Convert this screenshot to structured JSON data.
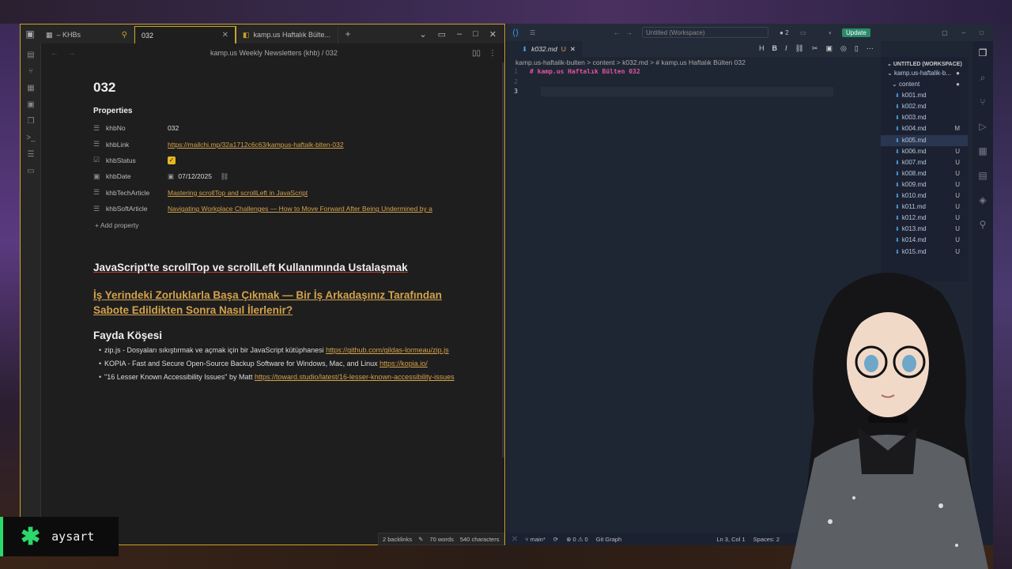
{
  "obsidian": {
    "tabs": [
      {
        "icon": "table-icon",
        "label": "– KHBs"
      },
      {
        "label": "032"
      },
      {
        "label": "kamp.us Haftalık Bülte..."
      }
    ],
    "breadcrumb": "kamp.us Weekly Newsletters (khb)  /  032",
    "note_title": "032",
    "properties_label": "Properties",
    "properties": [
      {
        "key": "khbNo",
        "value": "032"
      },
      {
        "key": "khbLink",
        "value": "https://mailchi.mp/32a1712c6c63/kampus-haftalk-blten-032"
      },
      {
        "key": "khbStatus",
        "value": "checked"
      },
      {
        "key": "khbDate",
        "value": "07/12/2025"
      },
      {
        "key": "khbTechArticle",
        "value": "Mastering scrollTop and scrollLeft in JavaScript"
      },
      {
        "key": "khbSoftArticle",
        "value": "Navigating Workplace Challenges — How to Move Forward After Being Undermined by a"
      }
    ],
    "add_property": "Add property",
    "heading1": "JavaScript'te scrollTop ve scrollLeft Kullanımında Ustalaşmak",
    "heading2": "İş Yerindeki Zorluklarla Başa Çıkmak — Bir İş Arkadaşınız Tarafından Sabote Edildikten Sonra Nasıl İlerlenir?",
    "heading3": "Fayda Köşesi",
    "list": [
      {
        "text": "zip.js - Dosyaları sıkıştırmak ve açmak için bir JavaScript kütüphanesi ",
        "link": "https://github.com/gildas-lormeau/zip.js"
      },
      {
        "text": "KOPIA - Fast and Secure Open-Source Backup Software for Windows, Mac, and Linux ",
        "link": "https://kopia.io/"
      },
      {
        "text": "\"16 Lesser Known Accessibility Issues\" by Matt ",
        "link": "https://toward.studio/latest/16-lesser-known-accessibility-issues"
      }
    ],
    "status": {
      "backlinks": "2 backlinks",
      "words": "70 words",
      "chars": "540 characters"
    }
  },
  "vscode": {
    "workspace": "Untitled (Workspace)",
    "update": "Update",
    "notif_count": "2",
    "tab": {
      "label": "k032.md",
      "state": "U"
    },
    "breadcrumb": "kamp.us-haftalik-bulten  >  content  >  k032.md  >  # kamp.us Haftalık Bülten 032",
    "lines": [
      {
        "n": "1",
        "text": "# kamp.us Haftalık Bülten 032"
      },
      {
        "n": "2",
        "text": ""
      },
      {
        "n": "3",
        "text": ""
      }
    ],
    "explorer": {
      "header": "UNTITLED (WORKSPACE)",
      "root": "kamp.us-haftalik-b...",
      "folder": "content",
      "files": [
        {
          "name": "k001.md",
          "st": ""
        },
        {
          "name": "k002.md",
          "st": ""
        },
        {
          "name": "k003.md",
          "st": ""
        },
        {
          "name": "k004.md",
          "st": "M"
        },
        {
          "name": "k005.md",
          "st": ""
        },
        {
          "name": "k006.md",
          "st": "U"
        },
        {
          "name": "k007.md",
          "st": "U"
        },
        {
          "name": "k008.md",
          "st": "U"
        },
        {
          "name": "k009.md",
          "st": "U"
        },
        {
          "name": "k010.md",
          "st": "U"
        },
        {
          "name": "k011.md",
          "st": "U"
        },
        {
          "name": "k012.md",
          "st": "U"
        },
        {
          "name": "k013.md",
          "st": "U"
        },
        {
          "name": "k014.md",
          "st": "U"
        },
        {
          "name": "k015.md",
          "st": "U"
        }
      ]
    },
    "status": {
      "branch": "main*",
      "errors": "0",
      "warnings": "0",
      "git_graph": "Git Graph",
      "position": "Ln 3, Col 1",
      "spaces": "Spaces: 2"
    }
  },
  "badge": {
    "name": "aysart"
  },
  "colors": {
    "accent": "#c9a227",
    "link": "#d4a24c",
    "brand_green": "#2bd96b",
    "md_heading": "#e0569e"
  }
}
